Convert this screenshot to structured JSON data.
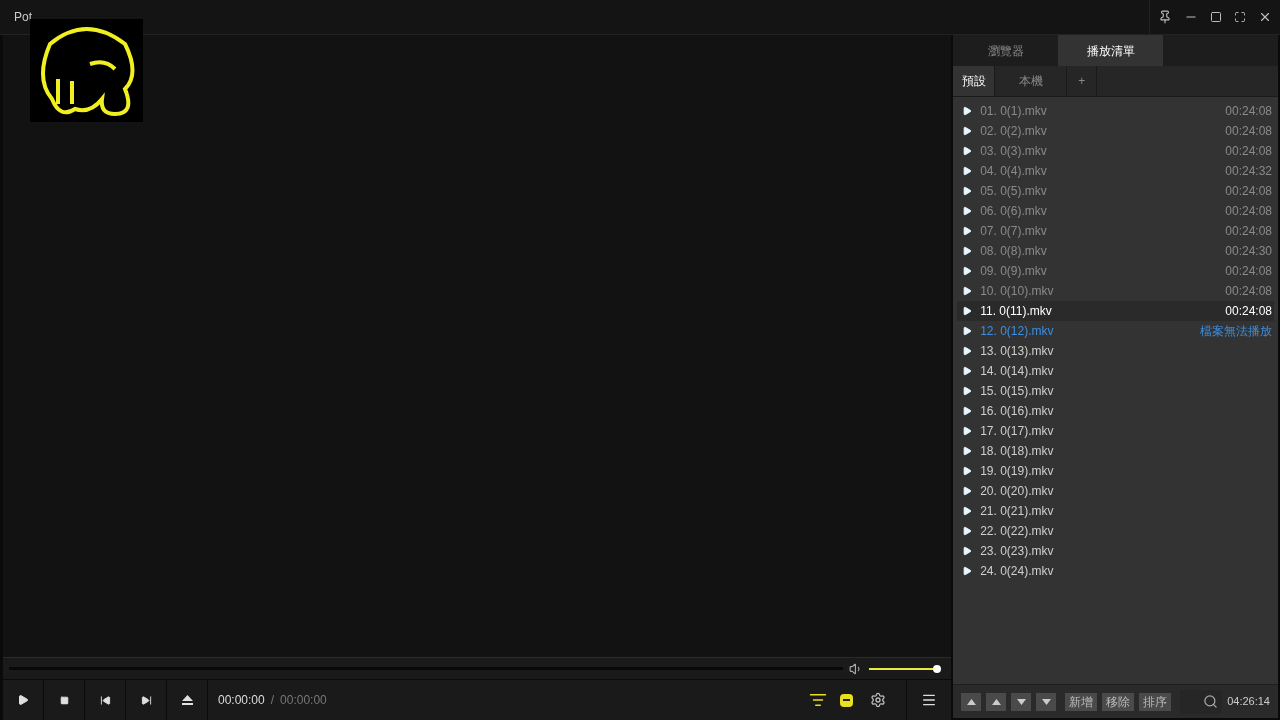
{
  "window": {
    "title": "Pot"
  },
  "player": {
    "volume": {
      "level": 1
    },
    "time_current": "00:00:00",
    "time_separator": "/",
    "time_total": "00:00:00"
  },
  "panel": {
    "tabs": [
      {
        "label": "瀏覽器",
        "selected": false
      },
      {
        "label": "播放清單",
        "selected": true
      }
    ],
    "subtabs": [
      {
        "label": "預設",
        "selected": true
      },
      {
        "label": "本機",
        "selected": false
      },
      {
        "label": "+",
        "selected": false
      }
    ],
    "items": [
      {
        "title": "01. 0(1).mkv",
        "duration": "00:24:08",
        "kind": "played"
      },
      {
        "title": "02. 0(2).mkv",
        "duration": "00:24:08",
        "kind": "played"
      },
      {
        "title": "03. 0(3).mkv",
        "duration": "00:24:08",
        "kind": "played"
      },
      {
        "title": "04. 0(4).mkv",
        "duration": "00:24:32",
        "kind": "played"
      },
      {
        "title": "05. 0(5).mkv",
        "duration": "00:24:08",
        "kind": "played"
      },
      {
        "title": "06. 0(6).mkv",
        "duration": "00:24:08",
        "kind": "played"
      },
      {
        "title": "07. 0(7).mkv",
        "duration": "00:24:08",
        "kind": "played"
      },
      {
        "title": "08. 0(8).mkv",
        "duration": "00:24:30",
        "kind": "played"
      },
      {
        "title": "09. 0(9).mkv",
        "duration": "00:24:08",
        "kind": "played"
      },
      {
        "title": "10. 0(10).mkv",
        "duration": "00:24:08",
        "kind": "played"
      },
      {
        "title": "11. 0(11).mkv",
        "duration": "00:24:08",
        "kind": "current"
      },
      {
        "title": "12. 0(12).mkv",
        "duration": "檔案無法播放",
        "kind": "error"
      },
      {
        "title": "13. 0(13).mkv",
        "kind": "unplayed"
      },
      {
        "title": "14. 0(14).mkv",
        "kind": "unplayed"
      },
      {
        "title": "15. 0(15).mkv",
        "kind": "unplayed"
      },
      {
        "title": "16. 0(16).mkv",
        "kind": "unplayed"
      },
      {
        "title": "17. 0(17).mkv",
        "kind": "unplayed"
      },
      {
        "title": "18. 0(18).mkv",
        "kind": "unplayed"
      },
      {
        "title": "19. 0(19).mkv",
        "kind": "unplayed"
      },
      {
        "title": "20. 0(20).mkv",
        "kind": "unplayed"
      },
      {
        "title": "21. 0(21).mkv",
        "kind": "unplayed"
      },
      {
        "title": "22. 0(22).mkv",
        "kind": "unplayed"
      },
      {
        "title": "23. 0(23).mkv",
        "kind": "unplayed"
      },
      {
        "title": "24. 0(24).mkv",
        "kind": "unplayed"
      }
    ],
    "buttons": [
      "新增",
      "移除",
      "排序"
    ],
    "total": "04:26:14"
  }
}
